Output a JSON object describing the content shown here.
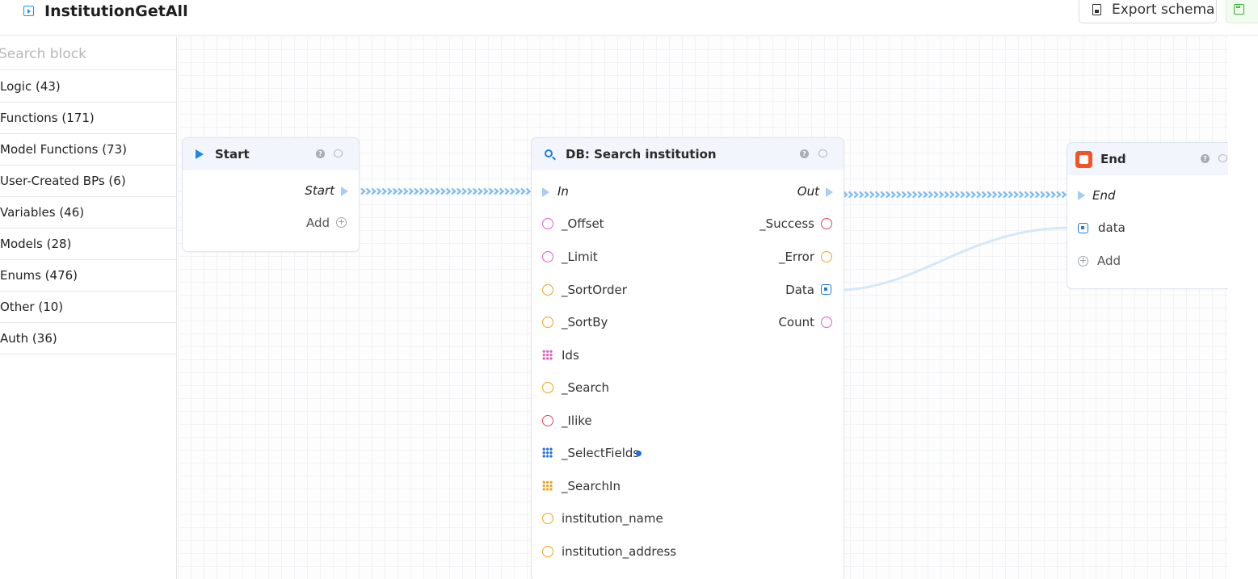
{
  "header": {
    "title": "InstitutionGetAll",
    "export_label": "Export schema"
  },
  "sidebar": {
    "search_placeholder": "Search block",
    "categories": [
      "Logic (43)",
      "Functions (171)",
      "Model Functions (73)",
      "User-Created BPs (6)",
      "Variables (46)",
      "Models (28)",
      "Enums (476)",
      "Other (10)",
      "Auth (36)"
    ]
  },
  "nodes": {
    "start": {
      "title": "Start",
      "exec_out": "Start",
      "add_label": "Add"
    },
    "search": {
      "title": "DB: Search institution",
      "exec_in": "In",
      "exec_out": "Out",
      "inputs": [
        "_Offset",
        "_Limit",
        "_SortOrder",
        "_SortBy",
        "Ids",
        "_Search",
        "_Ilike",
        "_SelectFields",
        "_SearchIn",
        "institution_name",
        "institution_address"
      ],
      "outputs": [
        "_Success",
        "_Error",
        "Data",
        "Count"
      ]
    },
    "end": {
      "title": "End",
      "exec_in": "End",
      "data_label": "data",
      "add_label": "Add"
    }
  },
  "colors": {
    "accent": "#1e88e5",
    "exec_wire": "#7dbcf5",
    "data_wire": "#d6e8f8",
    "end_icon": "#f05427",
    "save_green": "#34b233"
  }
}
